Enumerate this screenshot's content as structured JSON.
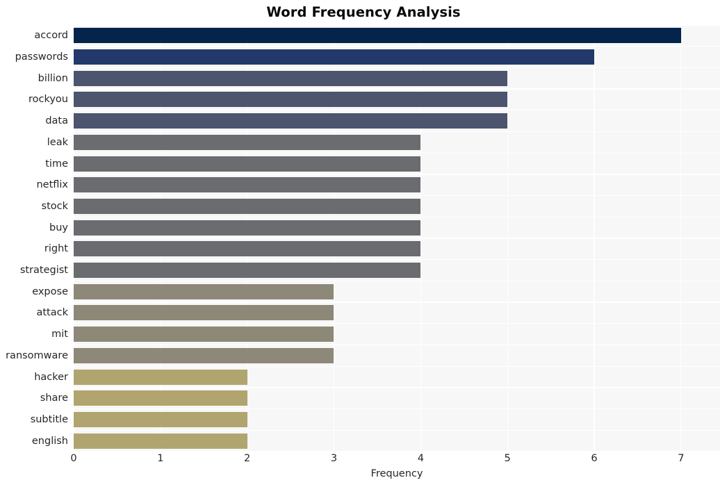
{
  "chart_data": {
    "type": "bar",
    "orientation": "horizontal",
    "title": "Word Frequency Analysis",
    "xlabel": "Frequency",
    "ylabel": "",
    "xlim": [
      0,
      7.45
    ],
    "xticks": [
      0,
      1,
      2,
      3,
      4,
      5,
      6,
      7
    ],
    "xticklabels": [
      "0",
      "1",
      "2",
      "3",
      "4",
      "5",
      "6",
      "7"
    ],
    "grid": true,
    "grid_color": "#ffffff",
    "legend": null,
    "plot_background": "#f7f7f7",
    "figure_background": "#ffffff",
    "categories": [
      "accord",
      "passwords",
      "billion",
      "rockyou",
      "data",
      "leak",
      "time",
      "netflix",
      "stock",
      "buy",
      "right",
      "strategist",
      "expose",
      "attack",
      "mit",
      "ransomware",
      "hacker",
      "share",
      "subtitle",
      "english"
    ],
    "values": [
      7,
      6,
      5,
      5,
      5,
      4,
      4,
      4,
      4,
      4,
      4,
      4,
      3,
      3,
      3,
      3,
      2,
      2,
      2,
      2
    ],
    "bar_colors": [
      "#04244c",
      "#23386b",
      "#4c546e",
      "#4c546e",
      "#4c546e",
      "#6b6c70",
      "#6b6c70",
      "#6b6c70",
      "#6b6c70",
      "#6b6c70",
      "#6b6c70",
      "#6b6c70",
      "#8d8878",
      "#8d8878",
      "#8d8878",
      "#8d8878",
      "#b0a56f",
      "#b0a56f",
      "#b0a56f",
      "#b0a56f"
    ]
  }
}
